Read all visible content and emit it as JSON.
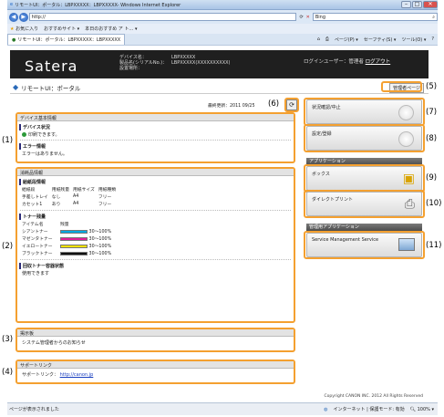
{
  "browser": {
    "title": "リモートUI：ポータル：LBPXXXXX：LBPXXXXX- Windows Internet Explorer",
    "url": "http://",
    "search_placeholder": "Bing",
    "favorites": "お気に入り",
    "fav_links": [
      "おすすめサイト ▾",
      "本日のおすすめ ア ト… ▾"
    ],
    "tab_label": "リモートUI：ポータル：LBPXXXXX：LBPXXXXX",
    "cmd_items": [
      "ページ(P) ▾",
      "セーフティ(S) ▾",
      "ツール(O) ▾"
    ],
    "status_left": "ページが表示されました",
    "status_zone": "インターネット | 保護モード: 有効",
    "zoom": "100%"
  },
  "header": {
    "logo": "Satera",
    "labels": [
      "デバイス名：",
      "製品名(シリアルNo.)：",
      "設置場所："
    ],
    "values": [
      "LBPXXXXX",
      "LBPXXXXX(XXXXXXXXXX)",
      ""
    ],
    "login_user": "ログインユーザー：管理者",
    "logout": "ログアウト"
  },
  "page": {
    "title": "リモートUI：ポータル",
    "admin_button": "管理者ページ",
    "last_update": "最終更新：2011 09/25"
  },
  "device_basic": {
    "title": "デバイス基本情報",
    "status_head": "デバイス状況",
    "status_text": "印刷できます。",
    "error_head": "エラー情報",
    "error_text": "エラーはありません。"
  },
  "consumables": {
    "title": "消耗品情報",
    "paper_head": "給紙段情報",
    "paper_cols": [
      "給紙段",
      "用紙残量",
      "用紙サイズ",
      "用紙種類"
    ],
    "paper_rows": [
      [
        "手差しトレイ",
        "なし",
        "A4",
        "フリー"
      ],
      [
        "カセット1",
        "あり",
        "A4",
        "フリー"
      ]
    ],
    "toner_head": "トナー残量",
    "toner_cols": [
      "アイテム名",
      "残量"
    ],
    "toner_rows": [
      {
        "name": "シアントナー",
        "range": "30～100%",
        "color": "#00a8e0",
        "level": 1.0
      },
      {
        "name": "マゼンタトナー",
        "range": "30～100%",
        "color": "#e0209a",
        "level": 1.0
      },
      {
        "name": "イエロートナー",
        "range": "30～100%",
        "color": "#f2e200",
        "level": 1.0
      },
      {
        "name": "ブラックトナー",
        "range": "30～100%",
        "color": "#111111",
        "level": 1.0
      }
    ],
    "waste_head": "回収トナー容器状態",
    "waste_text": "使用できます"
  },
  "board": {
    "title": "掲示板",
    "text": "システム管理者からのお知らせ"
  },
  "support": {
    "title": "サポートリンク",
    "label": "サポートリンク：",
    "link": "http://canon.jp"
  },
  "right": {
    "status_cancel": "状況確認/中止",
    "settings": "設定/登録",
    "apps_head": "アプリケーション",
    "box": "ボックス",
    "direct_print": "ダイレクトプリント",
    "mgmt_head": "管理用アプリケーション",
    "sms": "Service Management Service"
  },
  "callouts": [
    "(1)",
    "(2)",
    "(3)",
    "(4)",
    "(5)",
    "(6)",
    "(7)",
    "(8)",
    "(9)",
    "(10)",
    "(11)"
  ],
  "copyright": "Copyright CANON INC. 2012 All Rights Reserved"
}
